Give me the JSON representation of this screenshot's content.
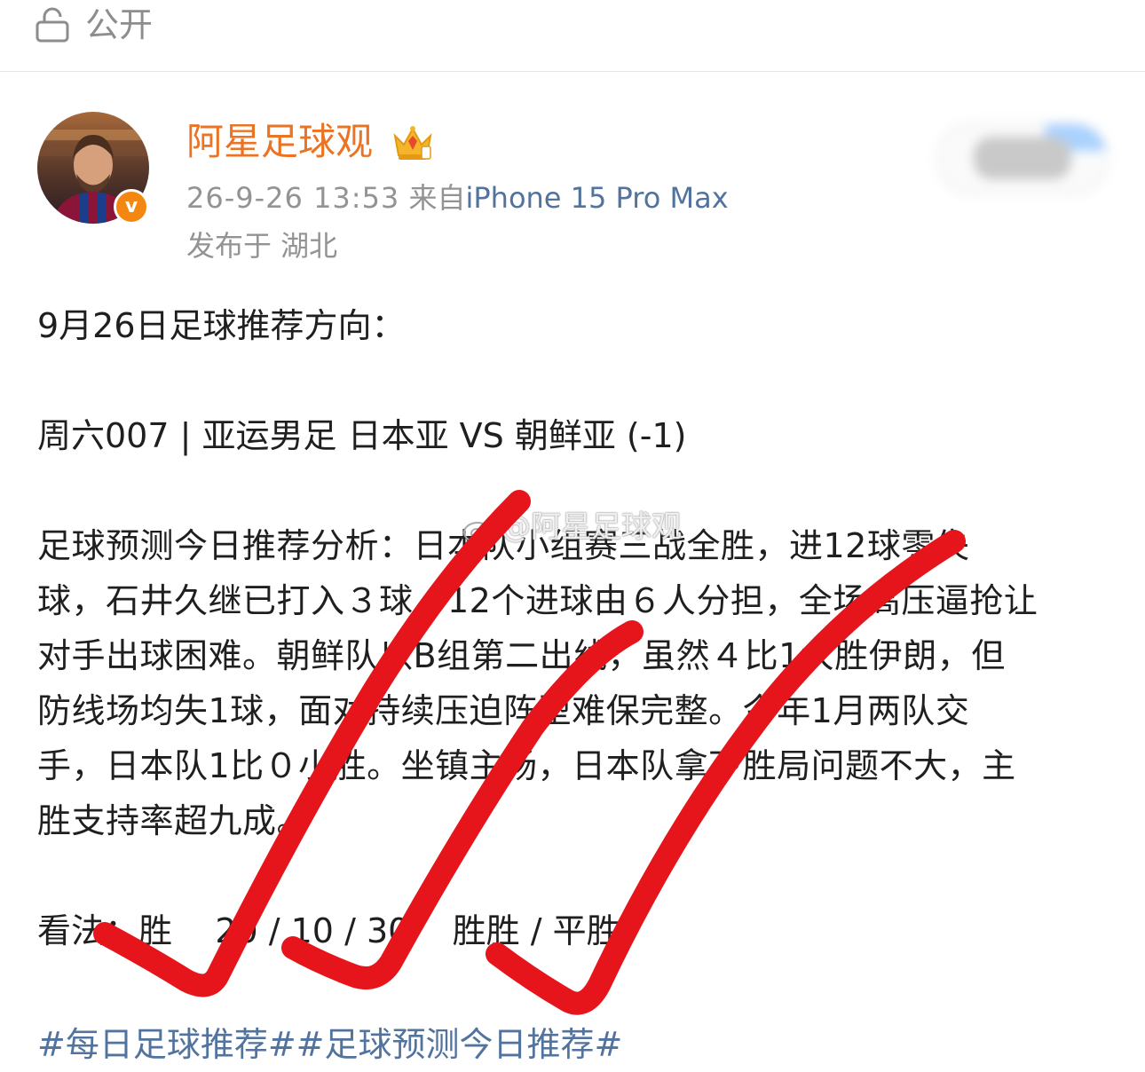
{
  "topbar": {
    "visibility_label": "公开"
  },
  "author": {
    "name": "阿星足球观",
    "timestamp": "26-9-26 13:53",
    "source_prefix": "来自",
    "device": "iPhone 15 Pro Max",
    "location": "发布于 湖北",
    "verified_badge": "v"
  },
  "post": {
    "title": "9月26日足球推荐方向：",
    "match": "周六007 | 亚运男足 日本亚 VS 朝鲜亚 (-1)",
    "analysis_lines": [
      "足球预测今日推荐分析：日本队小组赛三战全胜，进12球零失",
      "球，石井久继已打入３球，12个进球由６人分担，全场高压逼抢让",
      "对手出球困难。朝鲜队以B组第二出线，虽然４比1大胜伊朗，但",
      "防线场均失1球，面对持续压迫阵型难保完整。今年1月两队交",
      "手，日本队1比０小胜。坐镇主场，日本队拿下胜局问题不大，主",
      "胜支持率超九成。"
    ],
    "verdict": "看法：胜    20 / 10 / 30    胜胜 / 平胜",
    "hashtags": "#每日足球推荐##足球预测今日推荐#"
  },
  "watermark": {
    "text": "@阿星足球观"
  },
  "colors": {
    "username": "#eb7324",
    "link": "#51739e",
    "meta": "#939393",
    "check_marks": "#e6141b",
    "badge": "#f3870f"
  }
}
